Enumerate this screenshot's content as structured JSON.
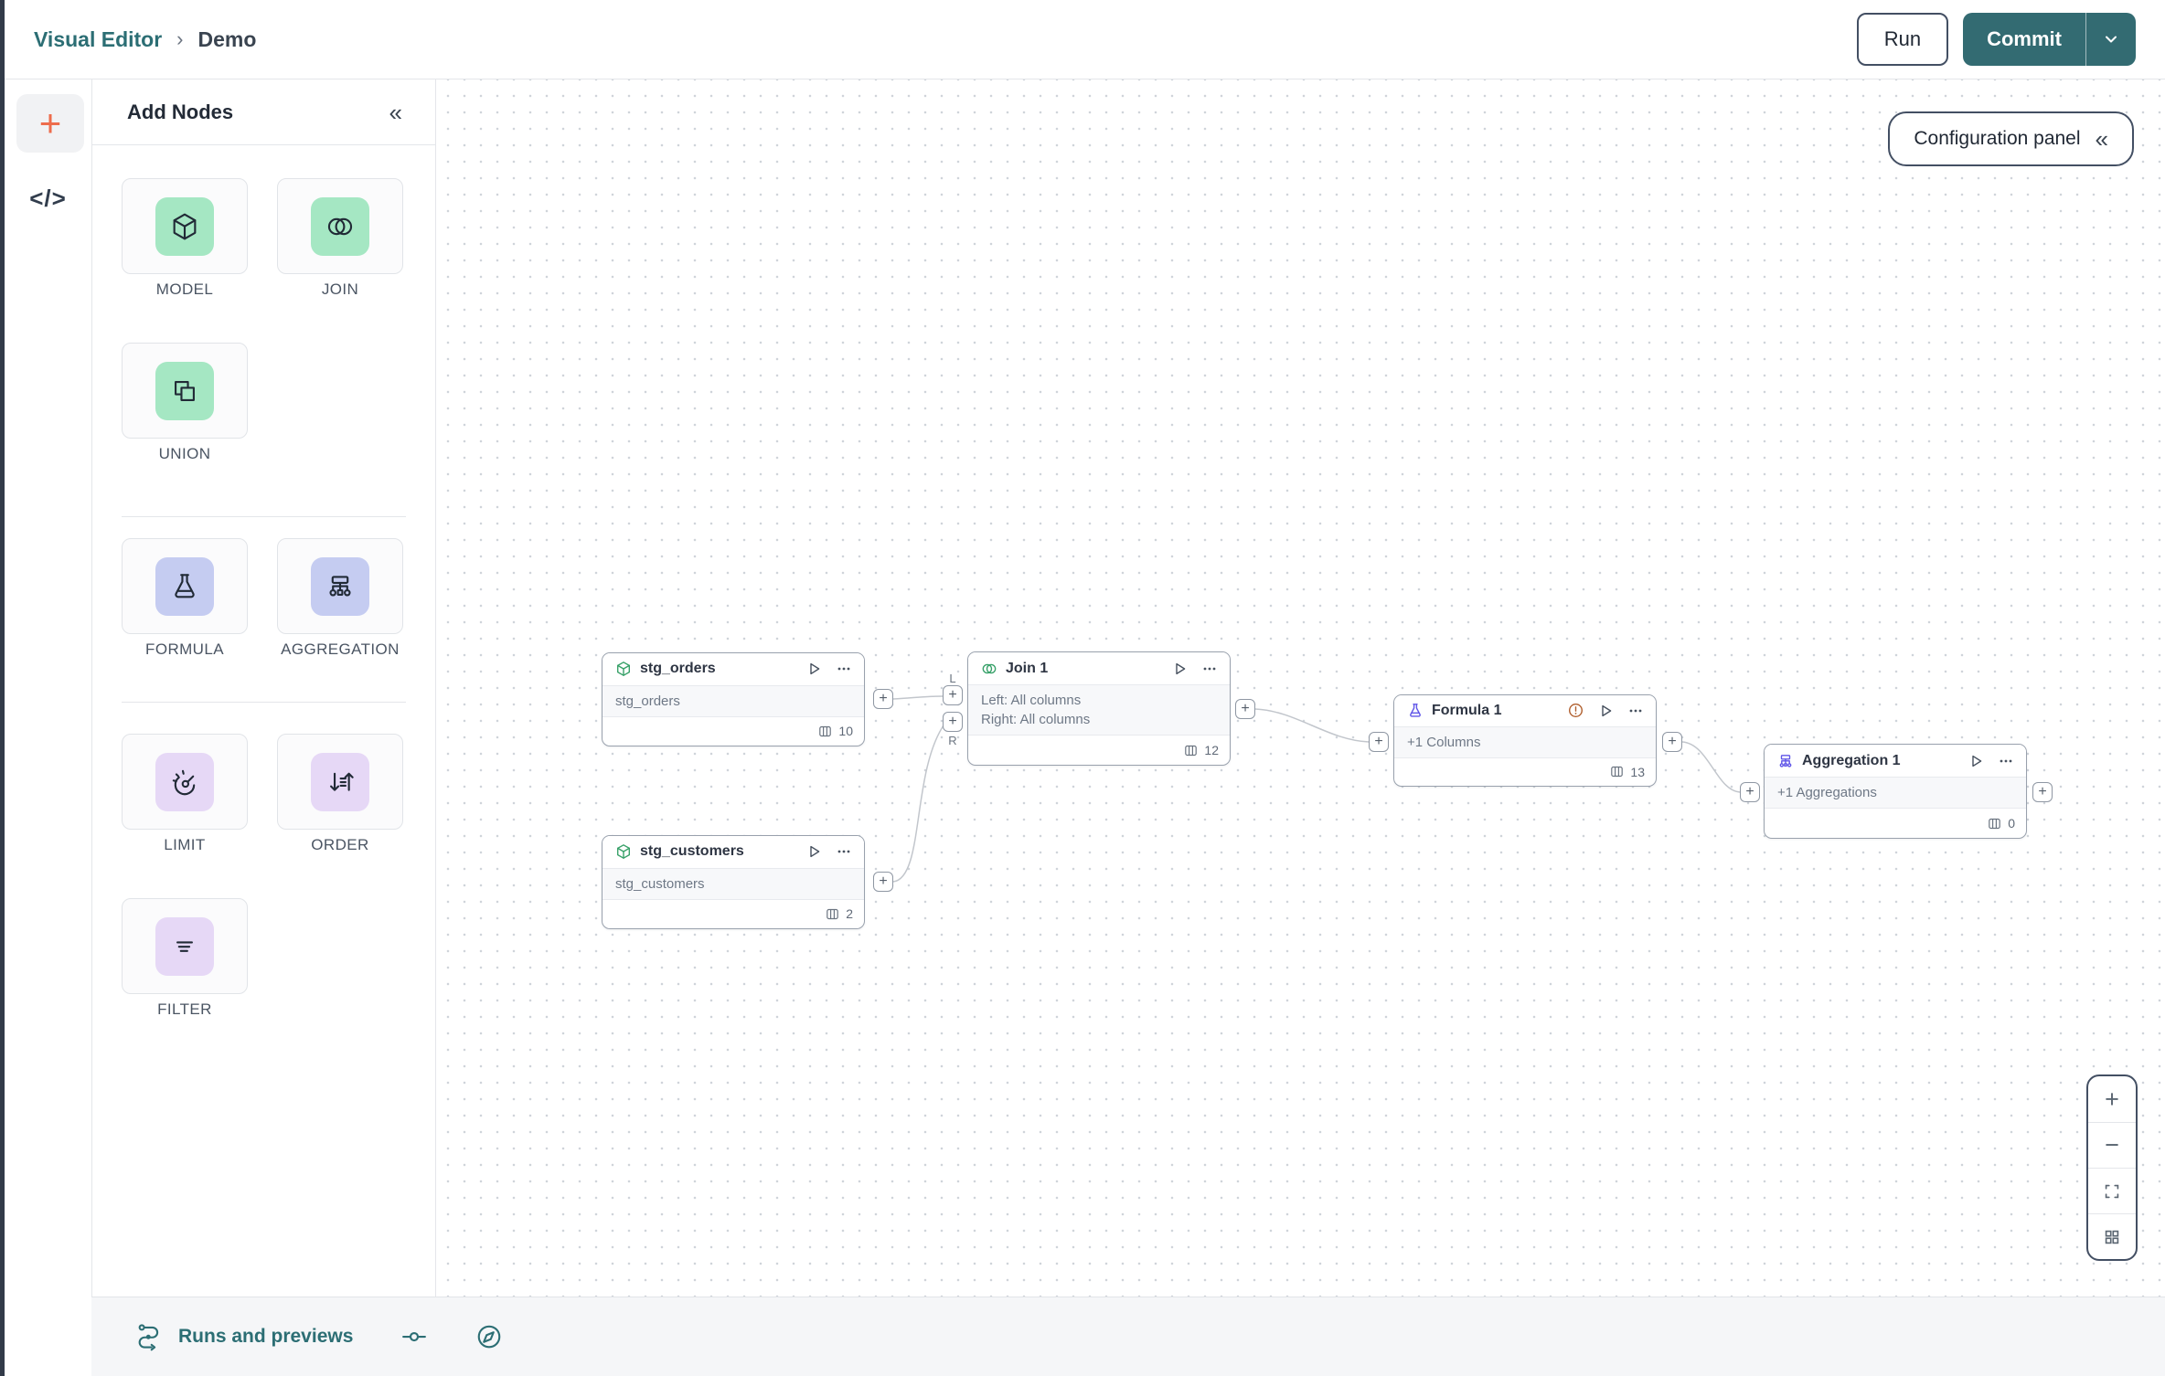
{
  "colors": {
    "brand_teal": "#336b72",
    "link_teal": "#2c6e74",
    "accent_orange": "#ed6c4c",
    "warning_orange": "#b05f2e",
    "node_icon_green": "#38a169",
    "node_icon_indigo": "#6056e8",
    "chip_green": "#a5e7c3",
    "chip_blue": "#c5ccf1",
    "chip_purple": "#e6d8f6"
  },
  "header": {
    "breadcrumb_root": "Visual Editor",
    "breadcrumb_separator": "›",
    "breadcrumb_current": "Demo",
    "run_label": "Run",
    "commit_label": "Commit"
  },
  "rail": {
    "add_glyph": "+",
    "code_glyph": "</>"
  },
  "toolbox": {
    "title": "Add Nodes",
    "collapse_glyph": "«",
    "tiles": [
      {
        "label": "MODEL"
      },
      {
        "label": "JOIN"
      },
      {
        "label": "UNION"
      },
      {
        "label": "FORMULA"
      },
      {
        "label": "AGGREGATION"
      },
      {
        "label": "LIMIT"
      },
      {
        "label": "ORDER"
      },
      {
        "label": "FILTER"
      }
    ]
  },
  "canvas": {
    "config_button_label": "Configuration panel",
    "config_collapse_glyph": "«",
    "port_plus": "+",
    "port_left_label": "L",
    "port_right_label": "R",
    "zoom_in_glyph": "+",
    "zoom_out_glyph": "−",
    "nodes": [
      {
        "title": "stg_orders",
        "body1": "stg_orders",
        "column_count": "10"
      },
      {
        "title": "Join 1",
        "body1": "Left: All columns",
        "body2": "Right: All columns",
        "column_count": "12"
      },
      {
        "title": "stg_customers",
        "body1": "stg_customers",
        "column_count": "2"
      },
      {
        "title": "Formula 1",
        "body1": "+1 Columns",
        "column_count": "13"
      },
      {
        "title": "Aggregation 1",
        "body1": "+1 Aggregations",
        "column_count": "0"
      }
    ]
  },
  "footer": {
    "runs_label": "Runs and previews"
  }
}
